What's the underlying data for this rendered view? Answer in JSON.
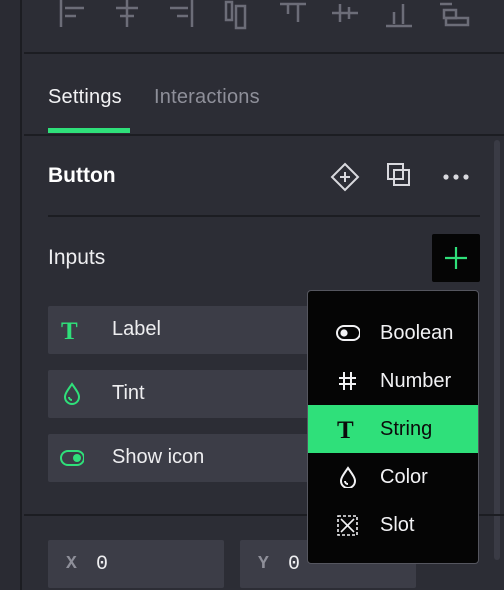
{
  "colors": {
    "accent": "#2fe07a",
    "panel_bg": "#2c2d35",
    "row_bg": "#3c3d47",
    "menu_bg": "#050505"
  },
  "toolbar": {
    "icons": [
      "align-left-icon",
      "align-center-horizontal-icon",
      "align-right-icon",
      "align-top-icon",
      "align-center-vertical-icon",
      "distribute-vertical-icon",
      "align-bottom-icon",
      "distribute-horizontal-icon"
    ]
  },
  "tabs": [
    {
      "label": "Settings",
      "active": true
    },
    {
      "label": "Interactions",
      "active": false
    }
  ],
  "component": {
    "title": "Button",
    "actions": [
      "component-icon",
      "duplicate-icon",
      "more-icon"
    ]
  },
  "inputs": {
    "label": "Inputs",
    "add_icon": "plus-icon",
    "items": [
      {
        "label": "Label",
        "icon": "text-type-icon"
      },
      {
        "label": "Tint",
        "icon": "droplet-icon"
      },
      {
        "label": "Show icon",
        "icon": "toggle-icon"
      }
    ]
  },
  "add_input_menu": {
    "items": [
      {
        "label": "Boolean",
        "icon": "toggle-icon",
        "selected": false
      },
      {
        "label": "Number",
        "icon": "hash-icon",
        "selected": false
      },
      {
        "label": "String",
        "icon": "text-type-icon",
        "selected": true
      },
      {
        "label": "Color",
        "icon": "droplet-icon",
        "selected": false
      },
      {
        "label": "Slot",
        "icon": "slot-icon",
        "selected": false
      }
    ]
  },
  "position": {
    "x_label": "X",
    "x_value": "0",
    "y_label": "Y",
    "y_value": "0"
  }
}
